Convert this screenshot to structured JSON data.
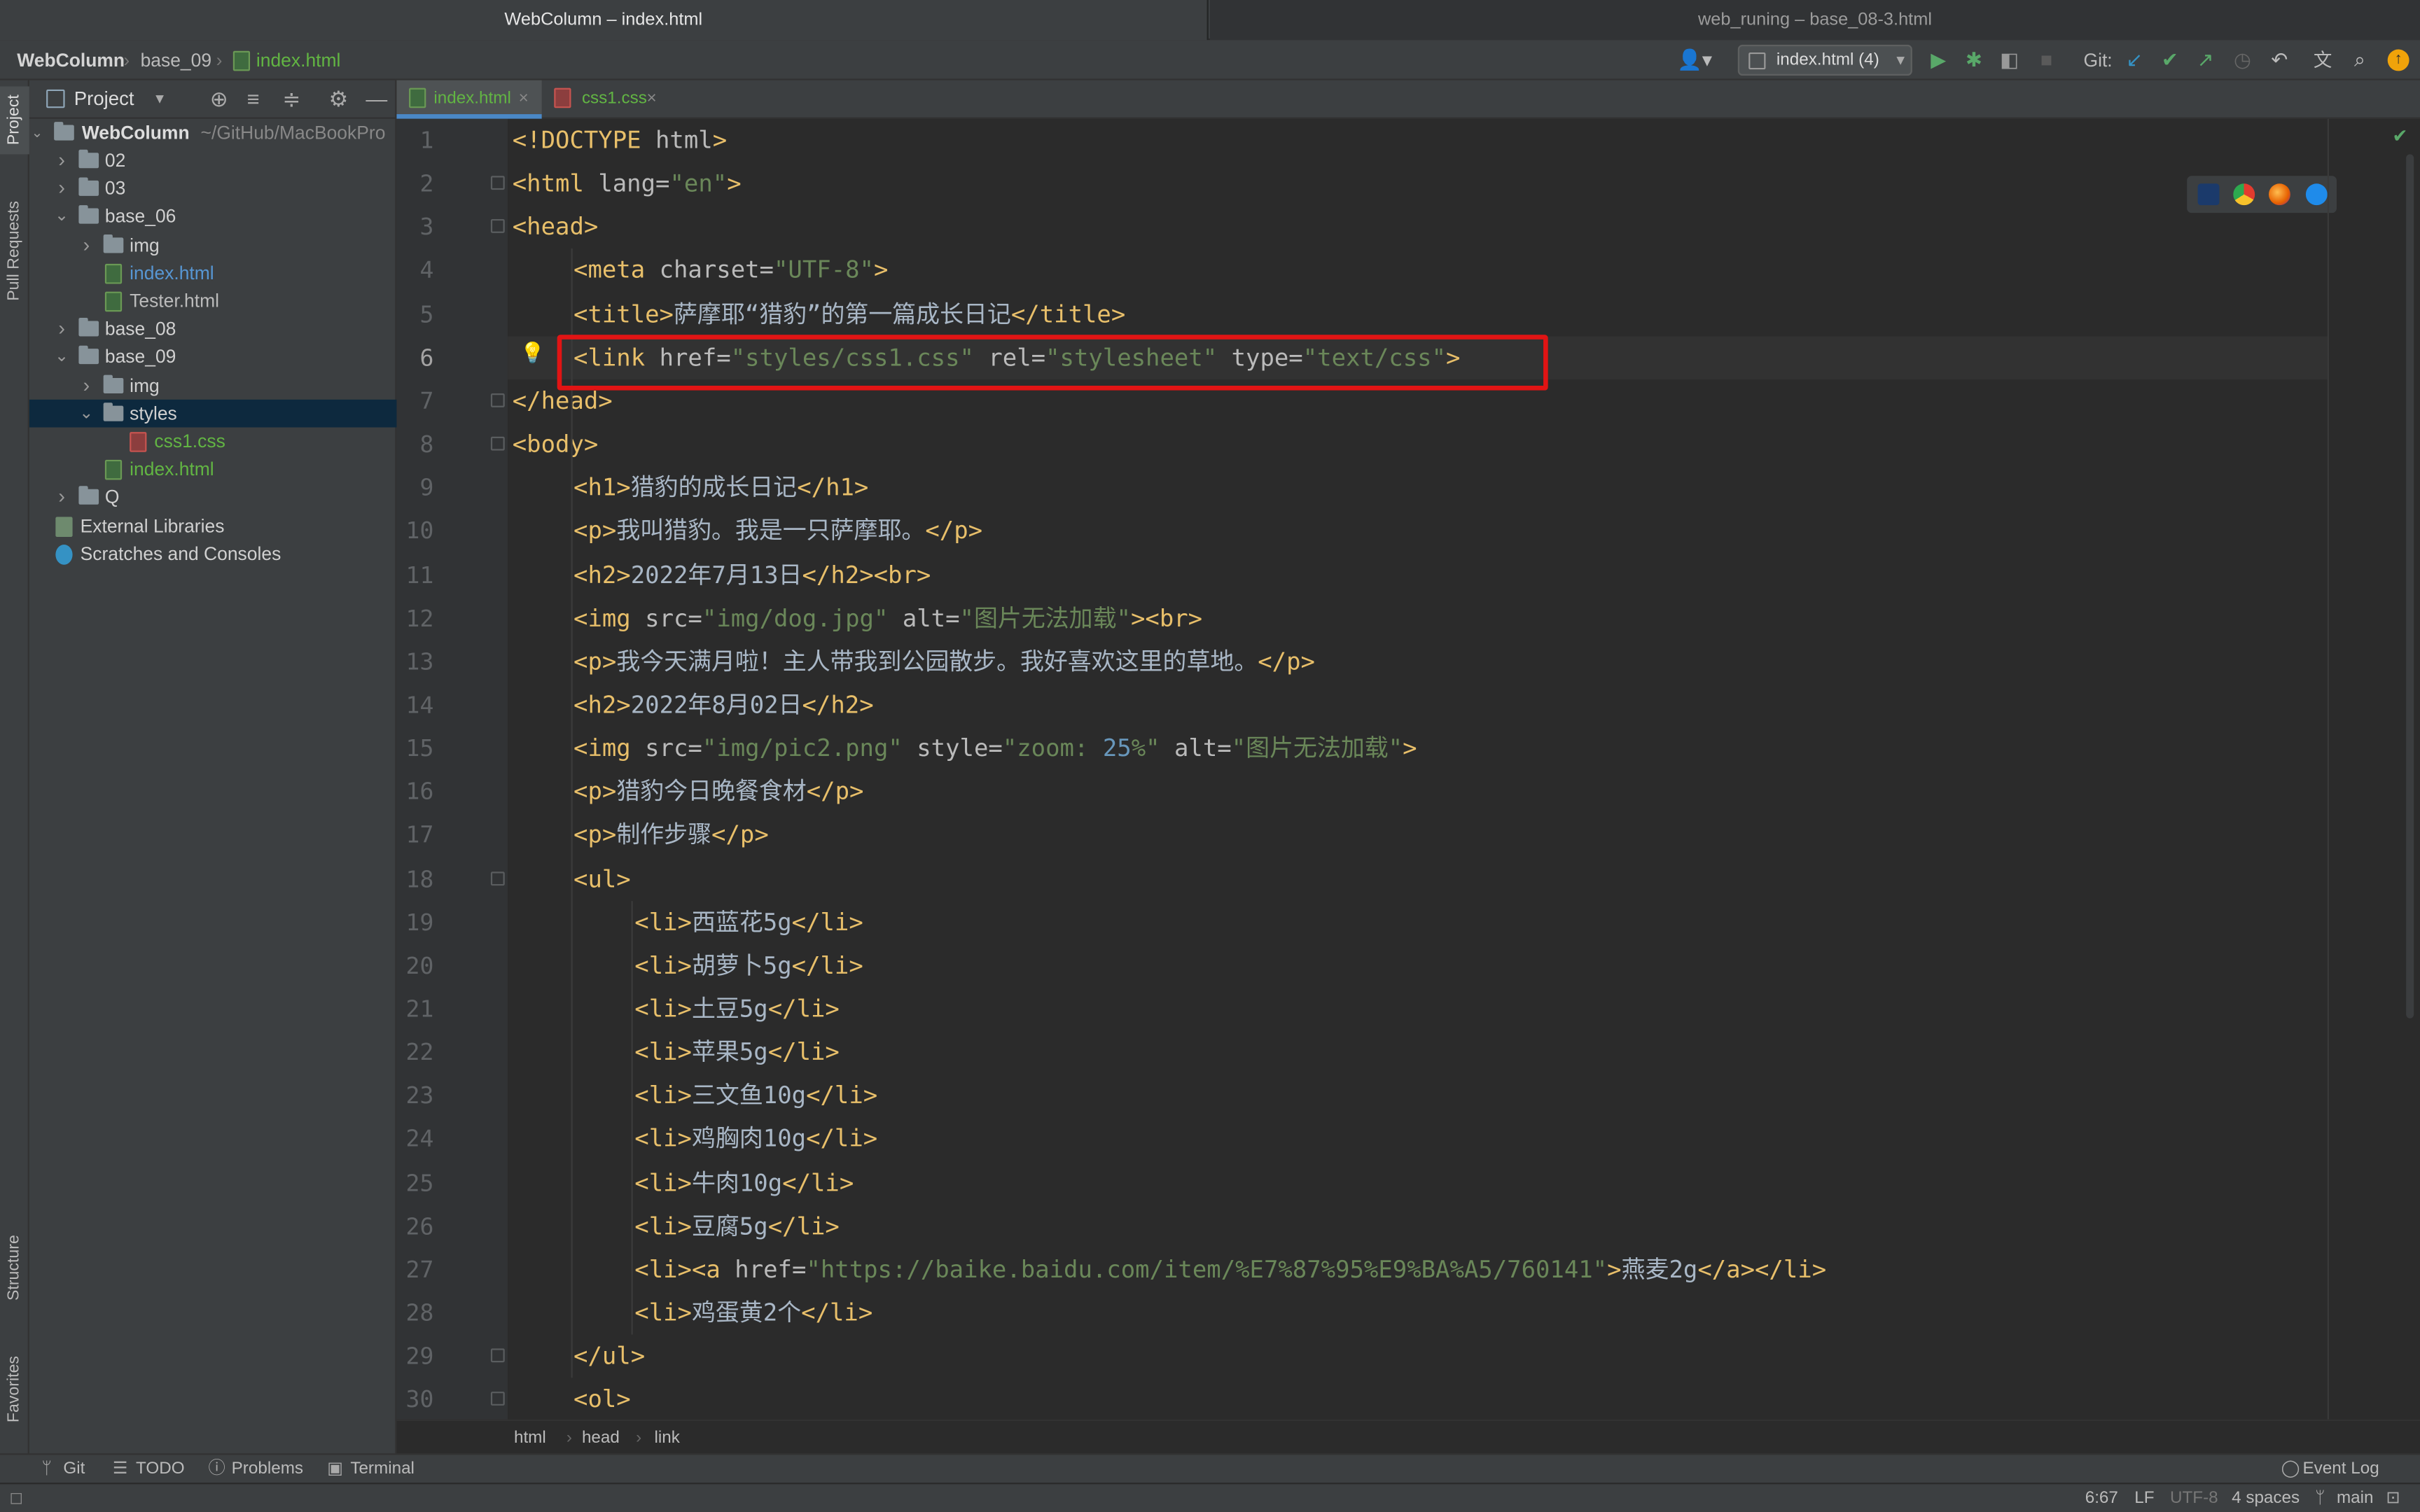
{
  "window_tabs": {
    "active": "WebColumn – index.html",
    "inactive": "web_runing – base_08-3.html"
  },
  "navbar": {
    "crumbs": [
      "WebColumn",
      "base_09",
      "index.html"
    ],
    "run_config": "index.html (4)",
    "git_label": "Git:"
  },
  "side_strip": {
    "project": "Project",
    "pull_requests": "Pull Requests",
    "structure": "Structure",
    "favorites": "Favorites"
  },
  "project_panel": {
    "title": "Project",
    "root_name": "WebColumn",
    "root_path": "~/GitHub/MacBookPro",
    "items": [
      {
        "label": "02",
        "type": "folder",
        "depth": 1,
        "expanded": false
      },
      {
        "label": "03",
        "type": "folder",
        "depth": 1,
        "expanded": false
      },
      {
        "label": "base_06",
        "type": "folder",
        "depth": 1,
        "expanded": true
      },
      {
        "label": "img",
        "type": "folder",
        "depth": 2,
        "expanded": false
      },
      {
        "label": "index.html",
        "type": "html",
        "depth": 2,
        "color": "#5796d3"
      },
      {
        "label": "Tester.html",
        "type": "html",
        "depth": 2,
        "color": "#bbbbbb"
      },
      {
        "label": "base_08",
        "type": "folder",
        "depth": 1,
        "expanded": false
      },
      {
        "label": "base_09",
        "type": "folder",
        "depth": 1,
        "expanded": true
      },
      {
        "label": "img",
        "type": "folder",
        "depth": 2,
        "expanded": false
      },
      {
        "label": "styles",
        "type": "folder",
        "depth": 2,
        "expanded": true,
        "selected": true
      },
      {
        "label": "css1.css",
        "type": "css",
        "depth": 3,
        "color": "#62b543"
      },
      {
        "label": "index.html",
        "type": "html",
        "depth": 2,
        "color": "#62b543"
      },
      {
        "label": "Q",
        "type": "folder",
        "depth": 1,
        "expanded": false
      },
      {
        "label": "External Libraries",
        "type": "lib",
        "depth": 0
      },
      {
        "label": "Scratches and Consoles",
        "type": "scratch",
        "depth": 0
      }
    ]
  },
  "editor_tabs": [
    {
      "label": "index.html",
      "active": true,
      "color": "#62b543"
    },
    {
      "label": "css1.css",
      "active": false,
      "color": "#62b543"
    }
  ],
  "code_lines": [
    {
      "n": "1",
      "ind": 0,
      "tokens": [
        [
          "t",
          "<!DOCTYPE "
        ],
        [
          "a",
          "html"
        ],
        [
          "t",
          ">"
        ]
      ]
    },
    {
      "n": "2",
      "ind": 0,
      "tokens": [
        [
          "t",
          "<html "
        ],
        [
          "a",
          "lang="
        ],
        [
          "v",
          "\"en\""
        ],
        [
          "t",
          ">"
        ]
      ]
    },
    {
      "n": "3",
      "ind": 0,
      "tokens": [
        [
          "t",
          "<head>"
        ]
      ]
    },
    {
      "n": "4",
      "ind": 1,
      "tokens": [
        [
          "t",
          "<meta "
        ],
        [
          "a",
          "charset="
        ],
        [
          "v",
          "\"UTF-8\""
        ],
        [
          "t",
          ">"
        ]
      ]
    },
    {
      "n": "5",
      "ind": 1,
      "tokens": [
        [
          "t",
          "<title>"
        ],
        [
          "tx",
          "萨摩耶“猎豹”的第一篇成长日记"
        ],
        [
          "t",
          "</title>"
        ]
      ]
    },
    {
      "n": "6",
      "ind": 1,
      "tokens": [
        [
          "t",
          "<link "
        ],
        [
          "a",
          "href="
        ],
        [
          "v",
          "\"styles/css1.css\""
        ],
        [
          "a",
          " rel="
        ],
        [
          "v",
          "\"stylesheet\""
        ],
        [
          "a",
          " type="
        ],
        [
          "v",
          "\"text/css\""
        ],
        [
          "t",
          ">"
        ]
      ]
    },
    {
      "n": "7",
      "ind": 0,
      "tokens": [
        [
          "t",
          "</head>"
        ]
      ]
    },
    {
      "n": "8",
      "ind": 0,
      "tokens": [
        [
          "t",
          "<body>"
        ]
      ]
    },
    {
      "n": "9",
      "ind": 1,
      "tokens": [
        [
          "t",
          "<h1>"
        ],
        [
          "tx",
          "猎豹的成长日记"
        ],
        [
          "t",
          "</h1>"
        ]
      ]
    },
    {
      "n": "10",
      "ind": 1,
      "tokens": [
        [
          "t",
          "<p>"
        ],
        [
          "tx",
          "我叫猎豹。我是一只萨摩耶。"
        ],
        [
          "t",
          "</p>"
        ]
      ]
    },
    {
      "n": "11",
      "ind": 1,
      "tokens": [
        [
          "t",
          "<h2>"
        ],
        [
          "tx",
          "2022年7月13日"
        ],
        [
          "t",
          "</h2><br>"
        ]
      ]
    },
    {
      "n": "12",
      "ind": 1,
      "tokens": [
        [
          "t",
          "<img "
        ],
        [
          "a",
          "src="
        ],
        [
          "v",
          "\"img/dog.jpg\""
        ],
        [
          "a",
          " alt="
        ],
        [
          "v",
          "\"图片无法加载\""
        ],
        [
          "t",
          "><br>"
        ]
      ]
    },
    {
      "n": "13",
      "ind": 1,
      "tokens": [
        [
          "t",
          "<p>"
        ],
        [
          "tx",
          "我今天满月啦！主人带我到公园散步。我好喜欢这里的草地。"
        ],
        [
          "t",
          "</p>"
        ]
      ]
    },
    {
      "n": "14",
      "ind": 1,
      "tokens": [
        [
          "t",
          "<h2>"
        ],
        [
          "tx",
          "2022年8月02日"
        ],
        [
          "t",
          "</h2>"
        ]
      ]
    },
    {
      "n": "15",
      "ind": 1,
      "tokens": [
        [
          "t",
          "<img "
        ],
        [
          "a",
          "src="
        ],
        [
          "v",
          "\"img/pic2.png\""
        ],
        [
          "a",
          " style="
        ],
        [
          "v",
          "\"zoom: "
        ],
        [
          "n",
          "25"
        ],
        [
          "v",
          "%\""
        ],
        [
          "a",
          " alt="
        ],
        [
          "v",
          "\"图片无法加载\""
        ],
        [
          "t",
          ">"
        ]
      ]
    },
    {
      "n": "16",
      "ind": 1,
      "tokens": [
        [
          "t",
          "<p>"
        ],
        [
          "tx",
          "猎豹今日晚餐食材"
        ],
        [
          "t",
          "</p>"
        ]
      ]
    },
    {
      "n": "17",
      "ind": 1,
      "tokens": [
        [
          "t",
          "<p>"
        ],
        [
          "tx",
          "制作步骤"
        ],
        [
          "t",
          "</p>"
        ]
      ]
    },
    {
      "n": "18",
      "ind": 1,
      "tokens": [
        [
          "t",
          "<ul>"
        ]
      ]
    },
    {
      "n": "19",
      "ind": 2,
      "tokens": [
        [
          "t",
          "<li>"
        ],
        [
          "tx",
          "西蓝花5g"
        ],
        [
          "t",
          "</li>"
        ]
      ]
    },
    {
      "n": "20",
      "ind": 2,
      "tokens": [
        [
          "t",
          "<li>"
        ],
        [
          "tx",
          "胡萝卜5g"
        ],
        [
          "t",
          "</li>"
        ]
      ]
    },
    {
      "n": "21",
      "ind": 2,
      "tokens": [
        [
          "t",
          "<li>"
        ],
        [
          "tx",
          "土豆5g"
        ],
        [
          "t",
          "</li>"
        ]
      ]
    },
    {
      "n": "22",
      "ind": 2,
      "tokens": [
        [
          "t",
          "<li>"
        ],
        [
          "tx",
          "苹果5g"
        ],
        [
          "t",
          "</li>"
        ]
      ]
    },
    {
      "n": "23",
      "ind": 2,
      "tokens": [
        [
          "t",
          "<li>"
        ],
        [
          "tx",
          "三文鱼10g"
        ],
        [
          "t",
          "</li>"
        ]
      ]
    },
    {
      "n": "24",
      "ind": 2,
      "tokens": [
        [
          "t",
          "<li>"
        ],
        [
          "tx",
          "鸡胸肉10g"
        ],
        [
          "t",
          "</li>"
        ]
      ]
    },
    {
      "n": "25",
      "ind": 2,
      "tokens": [
        [
          "t",
          "<li>"
        ],
        [
          "tx",
          "牛肉10g"
        ],
        [
          "t",
          "</li>"
        ]
      ]
    },
    {
      "n": "26",
      "ind": 2,
      "tokens": [
        [
          "t",
          "<li>"
        ],
        [
          "tx",
          "豆腐5g"
        ],
        [
          "t",
          "</li>"
        ]
      ]
    },
    {
      "n": "27",
      "ind": 2,
      "tokens": [
        [
          "t",
          "<li><a "
        ],
        [
          "a",
          "href="
        ],
        [
          "v",
          "\"https://baike.baidu.com/item/%E7%87%95%E9%BA%A5/760141\""
        ],
        [
          "t",
          ">"
        ],
        [
          "tx",
          "燕麦2g"
        ],
        [
          "t",
          "</a></li>"
        ]
      ]
    },
    {
      "n": "28",
      "ind": 2,
      "tokens": [
        [
          "t",
          "<li>"
        ],
        [
          "tx",
          "鸡蛋黄2个"
        ],
        [
          "t",
          "</li>"
        ]
      ]
    },
    {
      "n": "29",
      "ind": 1,
      "tokens": [
        [
          "t",
          "</ul>"
        ]
      ]
    },
    {
      "n": "30",
      "ind": 1,
      "tokens": [
        [
          "t",
          "<ol>"
        ]
      ]
    }
  ],
  "current_line": "6",
  "highlighted_line": "6",
  "breadcrumb": [
    "html",
    "head",
    "link"
  ],
  "tool_windows": [
    "Git",
    "TODO",
    "Problems",
    "Terminal"
  ],
  "event_log": "Event Log",
  "status": {
    "position": "6:67",
    "line_sep": "LF",
    "encoding": "UTF-8",
    "indent": "4 spaces",
    "branch": "main"
  },
  "colors": {
    "tag": "#e8bf6a",
    "attr": "#bababa",
    "value": "#6a8759",
    "number": "#6897bb",
    "highlight": "#e11414",
    "selection": "#0d293e"
  }
}
